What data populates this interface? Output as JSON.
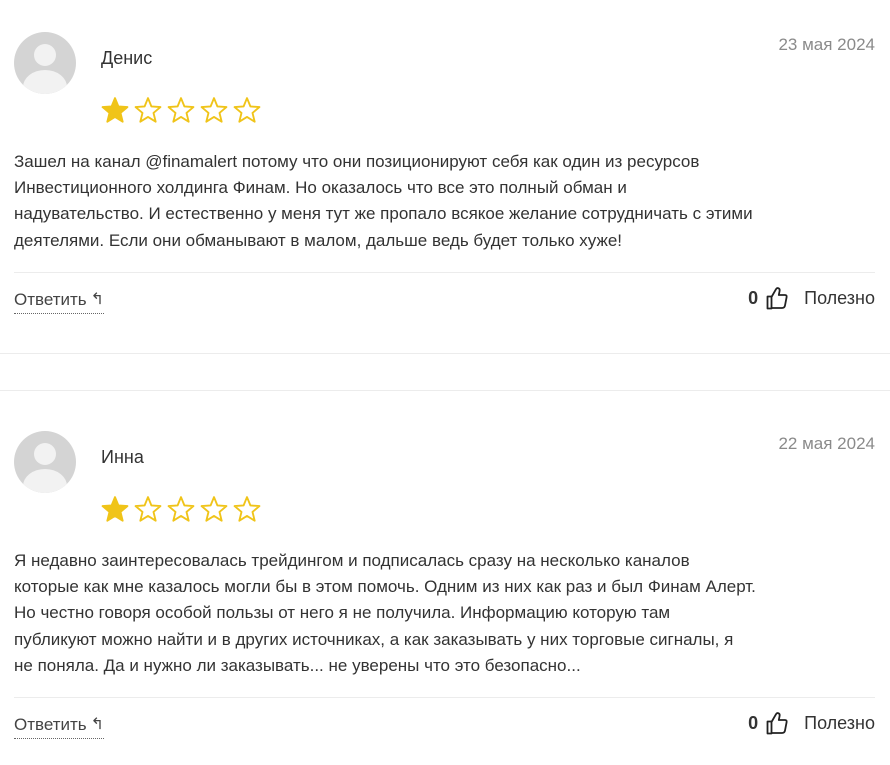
{
  "reviews": [
    {
      "author": "Денис",
      "date": "23 мая 2024",
      "rating": 1,
      "rating_max": 5,
      "lines": [
        "Зашел на канал @finamalert потому что они позиционируют себя как один из ресурсов",
        "Инвестиционного холдинга Финам. Но оказалось что все это полный обман и",
        "надувательство. И естественно у меня тут же пропало всякое желание сотрудничать с этими",
        "деятелями. Если они обманывают в малом, дальше ведь будет только хуже!"
      ],
      "reply_label": "Ответить",
      "useful_count": "0",
      "useful_label": "Полезно"
    },
    {
      "author": "Инна",
      "date": "22 мая 2024",
      "rating": 1,
      "rating_max": 5,
      "lines": [
        "Я недавно заинтересовалась трейдингом и подписалась сразу на несколько каналов",
        "которые как мне казалось могли бы в этом помочь. Одним из них как раз и был Финам Алерт.",
        "Но честно говоря особой пользы от него я не получила. Информацию которую там",
        "публикуют можно найти и в других источниках, а как заказывать у них торговые сигналы, я",
        "не поняла. Да и нужно ли заказывать... не уверены что это безопасно..."
      ],
      "reply_label": "Ответить",
      "useful_count": "0",
      "useful_label": "Полезно"
    }
  ],
  "icons": {
    "avatar": "user-avatar-icon",
    "star_filled": "star-filled-icon",
    "star_empty": "star-empty-icon",
    "reply": "reply-arrow-icon",
    "thumb": "thumbs-up-icon"
  },
  "colors": {
    "star": "#f0c419",
    "divider": "#ececec",
    "date": "#8a8a8a"
  }
}
